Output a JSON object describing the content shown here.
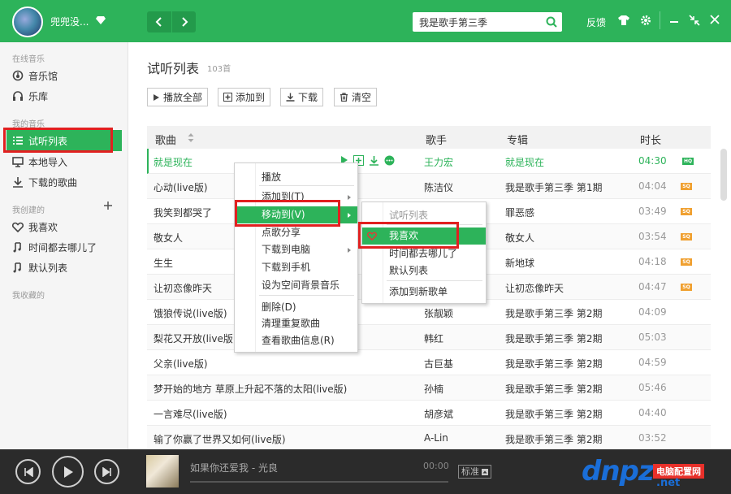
{
  "header": {
    "username": "兜兜没...",
    "search_value": "我是歌手第三季",
    "feedback": "反馈"
  },
  "sidebar": {
    "online_label": "在线音乐",
    "online": [
      {
        "label": "音乐馆",
        "icon": "music-hall-icon"
      },
      {
        "label": "乐库",
        "icon": "headphones-icon"
      }
    ],
    "mine_label": "我的音乐",
    "mine": [
      {
        "label": "试听列表",
        "icon": "list-icon",
        "active": true
      },
      {
        "label": "本地导入",
        "icon": "monitor-icon"
      },
      {
        "label": "下载的歌曲",
        "icon": "download-icon"
      }
    ],
    "created_label": "我创建的",
    "created": [
      {
        "label": "我喜欢",
        "icon": "heart-icon"
      },
      {
        "label": "时间都去哪儿了",
        "icon": "note-icon"
      },
      {
        "label": "默认列表",
        "icon": "note-icon"
      }
    ],
    "collected_label": "我收藏的"
  },
  "main": {
    "title": "试听列表",
    "count": "103首",
    "toolbar": {
      "play_all": "播放全部",
      "add_to": "添加到",
      "download": "下载",
      "clear": "清空"
    },
    "columns": {
      "song": "歌曲",
      "artist": "歌手",
      "album": "专辑",
      "duration": "时长"
    },
    "rows": [
      {
        "song": "就是现在",
        "artist": "王力宏",
        "album": "就是现在",
        "duration": "04:30",
        "quality": "HQ"
      },
      {
        "song": "心动(live版)",
        "artist": "陈洁仪",
        "album": "我是歌手第三季 第1期",
        "duration": "04:04",
        "quality": "SQ"
      },
      {
        "song": "我笑到都哭了",
        "artist": "",
        "album": "罪恶感",
        "duration": "03:49",
        "quality": "SQ"
      },
      {
        "song": "敬女人",
        "artist": "",
        "album": "敬女人",
        "duration": "03:54",
        "quality": "SQ"
      },
      {
        "song": "生生",
        "artist": "",
        "album": "新地球",
        "duration": "04:18",
        "quality": "SQ"
      },
      {
        "song": "让初恋像昨天",
        "artist": "",
        "album": "让初恋像昨天",
        "duration": "04:47",
        "quality": "SQ"
      },
      {
        "song": "饿狼传说(live版)",
        "artist": "张靓颖",
        "album": "我是歌手第三季 第2期",
        "duration": "04:09",
        "quality": ""
      },
      {
        "song": "梨花又开放(live版)",
        "artist": "韩红",
        "album": "我是歌手第三季 第2期",
        "duration": "05:03",
        "quality": ""
      },
      {
        "song": "父亲(live版)",
        "artist": "古巨基",
        "album": "我是歌手第三季 第2期",
        "duration": "04:59",
        "quality": ""
      },
      {
        "song": "梦开始的地方  草原上升起不落的太阳(live版)",
        "artist": "孙楠",
        "album": "我是歌手第三季 第2期",
        "duration": "05:46",
        "quality": ""
      },
      {
        "song": "一言难尽(live版)",
        "artist": "胡彦斌",
        "album": "我是歌手第三季 第2期",
        "duration": "04:40",
        "quality": ""
      },
      {
        "song": "输了你赢了世界又如何(live版)",
        "artist": "A-Lin",
        "album": "我是歌手第三季 第2期",
        "duration": "03:52",
        "quality": ""
      }
    ]
  },
  "context_menu": {
    "items": [
      "播放",
      "添加到(T)",
      "移动到(V)",
      "点歌分享",
      "下载到电脑",
      "下载到手机",
      "设为空间背景音乐",
      "删除(D)",
      "清理重复歌曲",
      "查看歌曲信息(R)"
    ]
  },
  "submenu": {
    "items": [
      "试听列表",
      "我喜欢",
      "时间都去哪儿了",
      "默认列表",
      "添加到新歌单"
    ]
  },
  "player": {
    "now_playing": "如果你还爱我  -  光良",
    "time": "00:00",
    "quality": "标准"
  },
  "watermark": {
    "logo": "dnpz",
    "badge": "电脑配置网",
    "url": ".net"
  },
  "colors": {
    "brand": "#2db35a",
    "highlight_box": "#e12020"
  }
}
